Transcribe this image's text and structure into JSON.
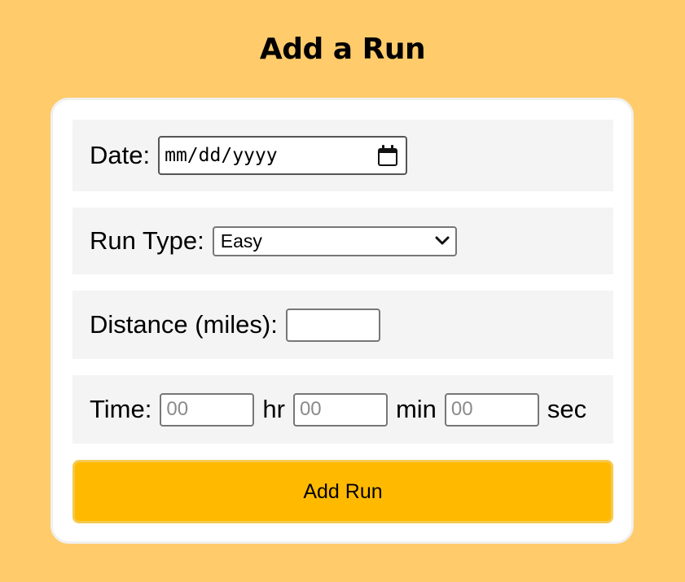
{
  "page": {
    "title": "Add a Run"
  },
  "form": {
    "date": {
      "label": "Date:",
      "placeholder": "mm/dd/yyyy",
      "icon": "calendar-icon"
    },
    "run_type": {
      "label": "Run Type:",
      "selected": "Easy",
      "options": [
        "Easy"
      ],
      "icon": "chevron-down-icon"
    },
    "distance": {
      "label": "Distance (miles):",
      "value": ""
    },
    "time": {
      "label": "Time:",
      "hours": {
        "placeholder": "00",
        "unit": "hr"
      },
      "minutes": {
        "placeholder": "00",
        "unit": "min"
      },
      "seconds": {
        "placeholder": "00",
        "unit": "sec"
      }
    },
    "submit_label": "Add Run"
  },
  "colors": {
    "background": "#FFCB6B",
    "card": "#FFFFFF",
    "row": "#F4F4F4",
    "button": "#FFBA00",
    "button_border": "#F5C950"
  }
}
